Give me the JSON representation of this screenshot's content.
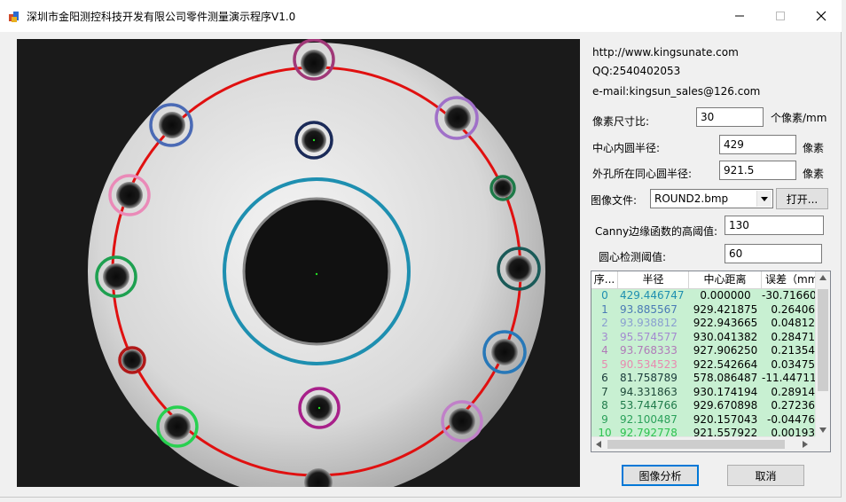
{
  "window": {
    "title": "深圳市金阳测控科技开发有限公司零件测量演示程序V1.0"
  },
  "info": {
    "url": "http://www.kingsunate.com",
    "qq": "QQ:2540402053",
    "email": "e-mail:kingsun_sales@126.com"
  },
  "params": {
    "pixel_ratio_label": "像素尺寸比:",
    "pixel_ratio_value": "30",
    "pixel_ratio_unit": "个像素/mm",
    "inner_radius_label": "中心内圆半径:",
    "inner_radius_value": "429",
    "inner_radius_unit": "像素",
    "outer_radius_label": "外孔所在同心圆半径:",
    "outer_radius_value": "921.5",
    "outer_radius_unit": "像素",
    "image_file_label": "图像文件:",
    "image_file_value": "ROUND2.bmp",
    "open_button": "打开...",
    "canny_label": "Canny边缘函数的高阈值:",
    "canny_value": "130",
    "circle_threshold_label": "圆心检测阈值:",
    "circle_threshold_value": "60"
  },
  "table": {
    "columns": [
      "序...",
      "半径",
      "中心距离",
      "误差（mm"
    ],
    "rows": [
      {
        "idx": "0",
        "radius": "429.446747",
        "distance": "0.000000",
        "error": "-30.71660",
        "color": "#1e8fb0"
      },
      {
        "idx": "1",
        "radius": "93.885567",
        "distance": "929.421875",
        "error": "0.26406",
        "color": "#4a7ab5"
      },
      {
        "idx": "2",
        "radius": "93.938812",
        "distance": "922.943665",
        "error": "0.04812",
        "color": "#8a9fd0"
      },
      {
        "idx": "3",
        "radius": "95.574577",
        "distance": "930.041382",
        "error": "0.28471",
        "color": "#a38ad0"
      },
      {
        "idx": "4",
        "radius": "93.768333",
        "distance": "927.906250",
        "error": "0.21354",
        "color": "#b07ab8"
      },
      {
        "idx": "5",
        "radius": "90.534523",
        "distance": "922.542664",
        "error": "0.03475",
        "color": "#e88ab0"
      },
      {
        "idx": "6",
        "radius": "81.758789",
        "distance": "578.086487",
        "error": "-11.44711",
        "color": "#1a3a3a"
      },
      {
        "idx": "7",
        "radius": "94.331863",
        "distance": "930.174194",
        "error": "0.28914",
        "color": "#1f4a3a"
      },
      {
        "idx": "8",
        "radius": "53.744766",
        "distance": "929.670898",
        "error": "0.27236",
        "color": "#1f7a4a"
      },
      {
        "idx": "9",
        "radius": "92.100487",
        "distance": "920.157043",
        "error": "-0.04476",
        "color": "#2aa05a"
      },
      {
        "idx": "10",
        "radius": "92.792778",
        "distance": "921.557922",
        "error": "0.00193",
        "color": "#2ec050"
      }
    ]
  },
  "buttons": {
    "analyze": "图像分析",
    "cancel": "取消"
  },
  "icons": {
    "minimize": "minimize-icon",
    "maximize": "maximize-icon",
    "close": "close-icon"
  }
}
